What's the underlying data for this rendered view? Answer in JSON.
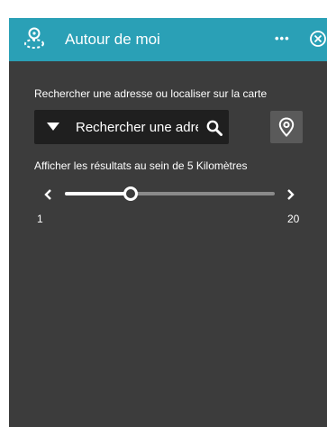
{
  "header": {
    "title": "Autour de moi",
    "icon": "locate-people-icon",
    "more_icon": "more-icon",
    "close_icon": "close-icon",
    "background": "#2aa0b6"
  },
  "search": {
    "prompt": "Rechercher une adresse ou localiser sur la carte",
    "placeholder": "Rechercher une adresse",
    "dropdown_icon": "caret-down-icon",
    "search_icon": "search-icon",
    "locate_icon": "map-pin-icon"
  },
  "radius": {
    "label": "Afficher les résultats au sein de 5 Kilomètres",
    "min_label": "1",
    "max_label": "20",
    "min": 1,
    "max": 20,
    "value": 5
  },
  "colors": {
    "panel_background": "#3c3c3c",
    "input_background": "#1f1f1f",
    "text": "#ffffff"
  }
}
